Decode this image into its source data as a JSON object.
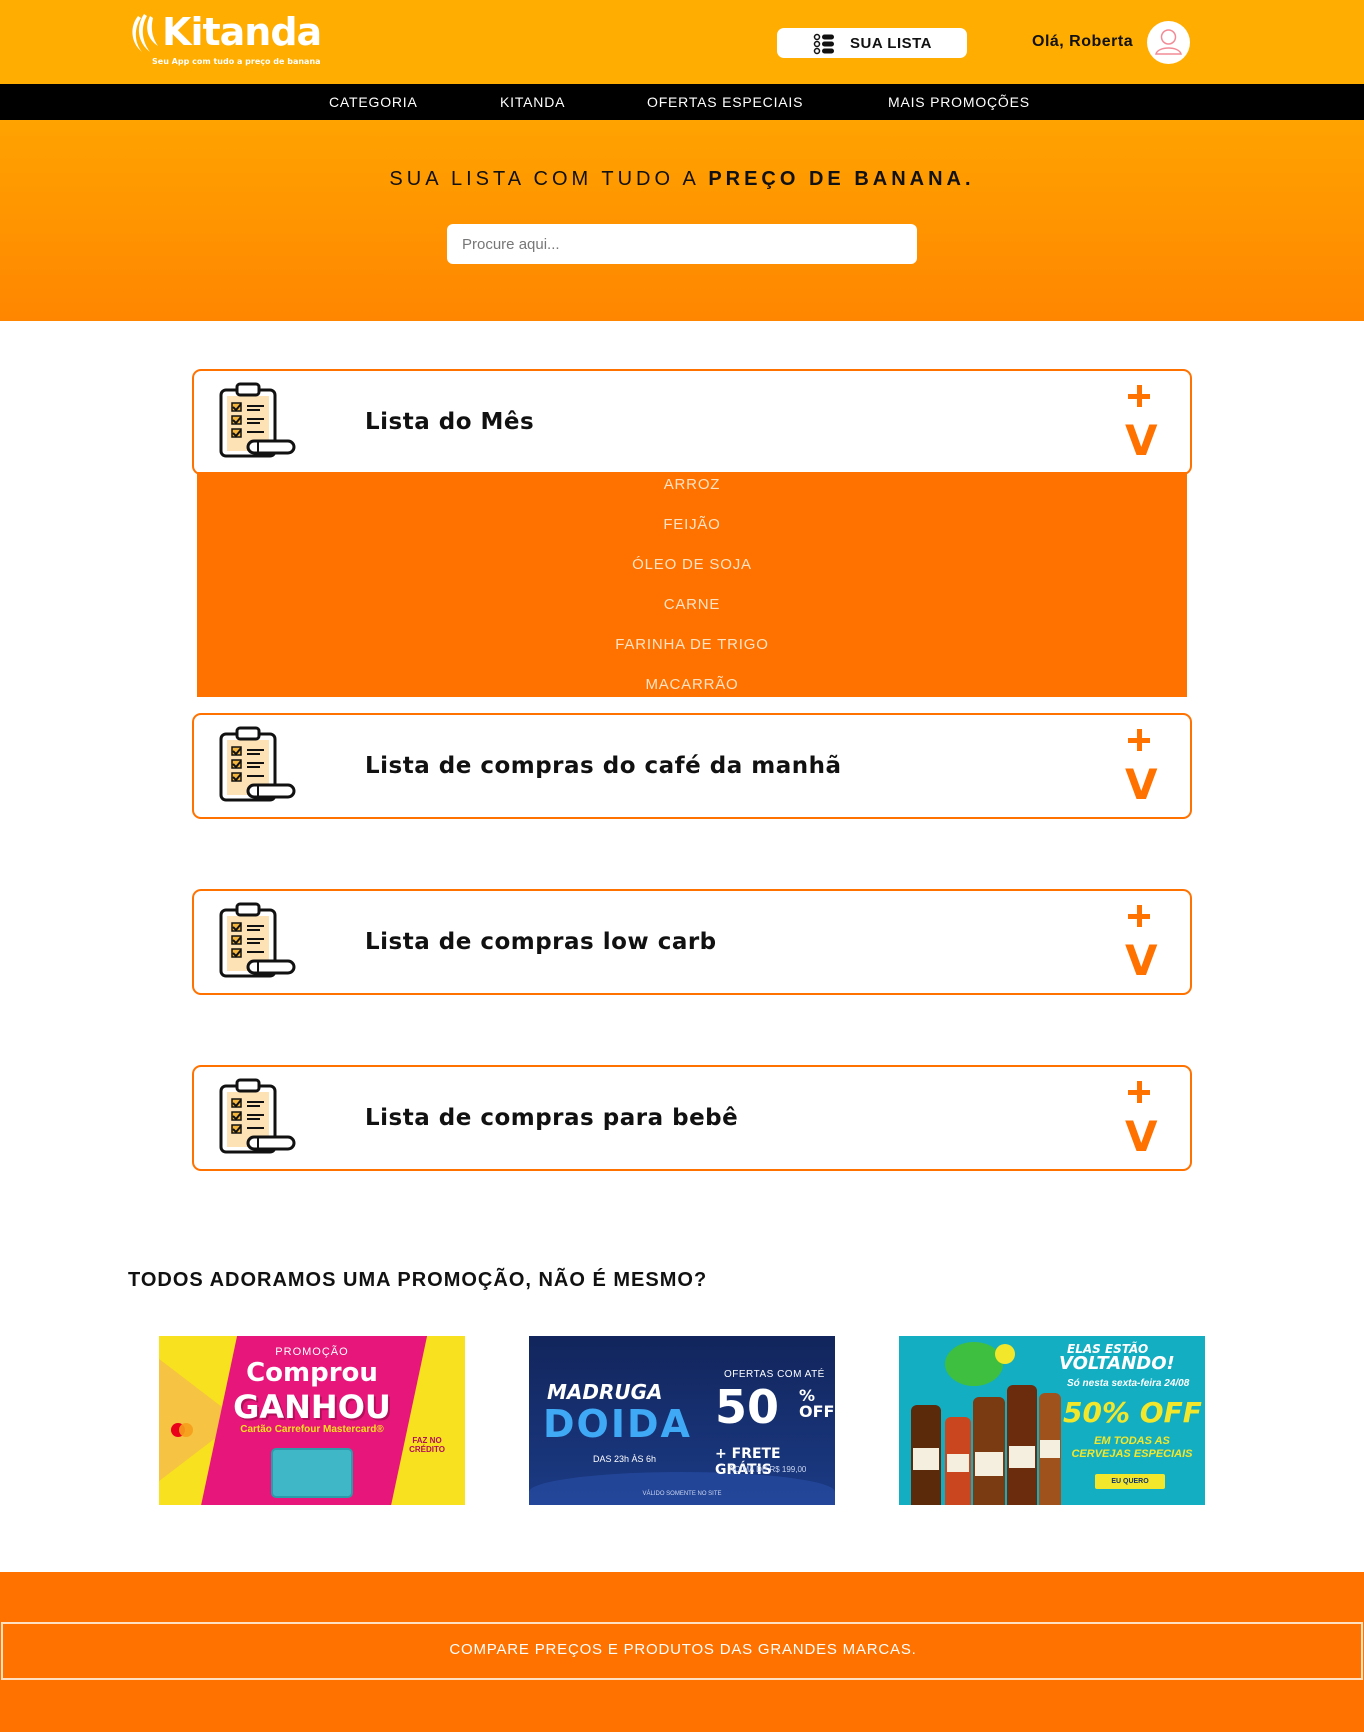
{
  "brand": {
    "name": "Kitanda",
    "tagline": "Seu App com tudo a preço de banana"
  },
  "header": {
    "list_button": "SUA LISTA",
    "greeting": "Olá, Roberta"
  },
  "nav": {
    "items": [
      "CATEGORIA",
      "KITANDA",
      "OFERTAS ESPECIAIS",
      "MAIS PROMOÇÕES"
    ]
  },
  "hero": {
    "title_normal": "SUA LISTA COM TUDO A ",
    "title_bold": "PREÇO DE BANANA.",
    "search_placeholder": "Procure aqui..."
  },
  "lists": [
    {
      "title": "Lista do Mês",
      "expanded": true
    },
    {
      "title": "Lista de compras do café da manhã",
      "expanded": false
    },
    {
      "title": "Lista de compras low carb",
      "expanded": false
    },
    {
      "title": "Lista de compras para bebê",
      "expanded": false
    }
  ],
  "dropdown": {
    "items": [
      "ARROZ",
      "FEIJÃO",
      "ÓLEO DE SOJA",
      "CARNE",
      "FARINHA DE TRIGO",
      "MACARRÃO"
    ]
  },
  "expand_icon": "plus-icon",
  "collapse_glyph": "V",
  "promo": {
    "heading": "TODOS ADORAMOS UMA PROMOÇÃO, NÃO É MESMO?",
    "banners": [
      {
        "promo": "PROMOÇÃO",
        "line1": "Comprou",
        "line2": "GANHOU",
        "sub": "Cartão Carrefour Mastercard®",
        "badge": "FAZ NO CRÉDITO"
      },
      {
        "title1": "MADRUGA",
        "title2": "DOIDA",
        "hours": "DAS 23h ÀS 6h",
        "offers_label": "OFERTAS COM ATÉ",
        "discount": "50",
        "off": "% OFF",
        "shipping": "+ FRETE GRÁTIS",
        "shipping_sub": "ACIMA DE R$ 199,00",
        "footnote": "VÁLIDO SOMENTE NO SITE"
      },
      {
        "line1": "ELAS ESTÃO",
        "line2": "VOLTANDO!",
        "line3": "Só nesta sexta-feira 24/08",
        "discount": "50% OFF",
        "line5": "EM TODAS AS CERVEJAS ESPECIAIS",
        "cta": "EU QUERO"
      }
    ]
  },
  "footer": {
    "text": "COMPARE PREÇOS E PRODUTOS DAS GRANDES MARCAS."
  },
  "colors": {
    "header": "#ffad00",
    "accent": "#ff7200",
    "nav": "#000000"
  }
}
